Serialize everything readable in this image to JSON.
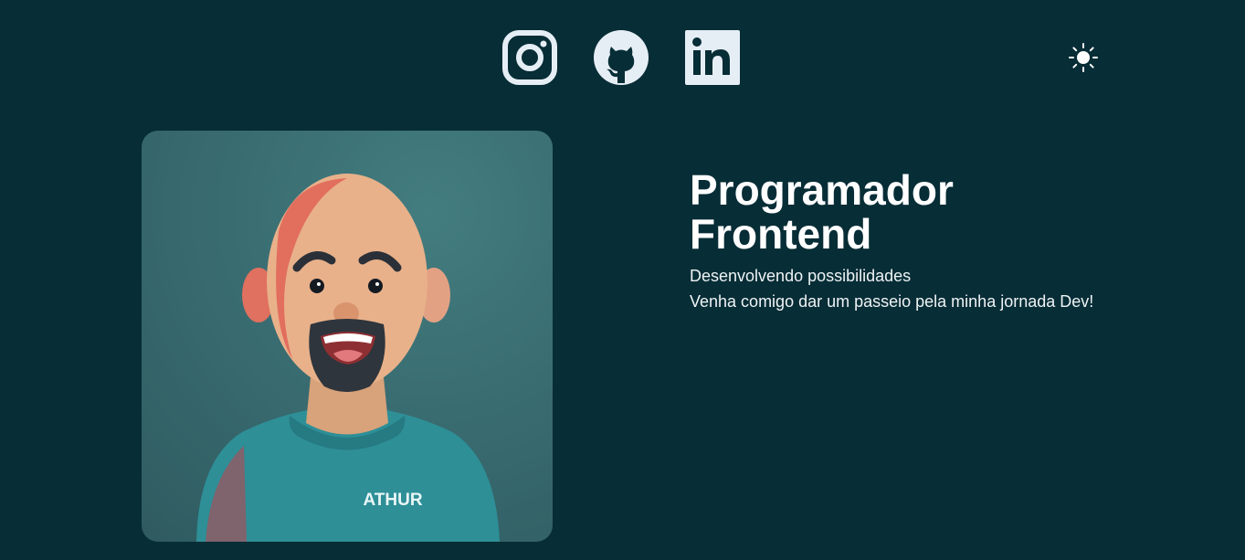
{
  "header": {
    "social_links": [
      {
        "name": "instagram",
        "icon": "instagram-icon"
      },
      {
        "name": "github",
        "icon": "github-icon"
      },
      {
        "name": "linkedin",
        "icon": "linkedin-icon"
      }
    ],
    "theme_toggle_icon": "sun-icon"
  },
  "hero": {
    "title_line1": "Programador",
    "title_line2": "Frontend",
    "subtitle_line1": "Desenvolvendo possibilidades",
    "subtitle_line2": "Venha comigo dar um passeio pela minha jornada Dev!"
  },
  "avatar": {
    "shirt_text": "ATHUR"
  },
  "colors": {
    "background": "#072d36",
    "icon": "#e6eef5",
    "text": "#ffffff"
  }
}
